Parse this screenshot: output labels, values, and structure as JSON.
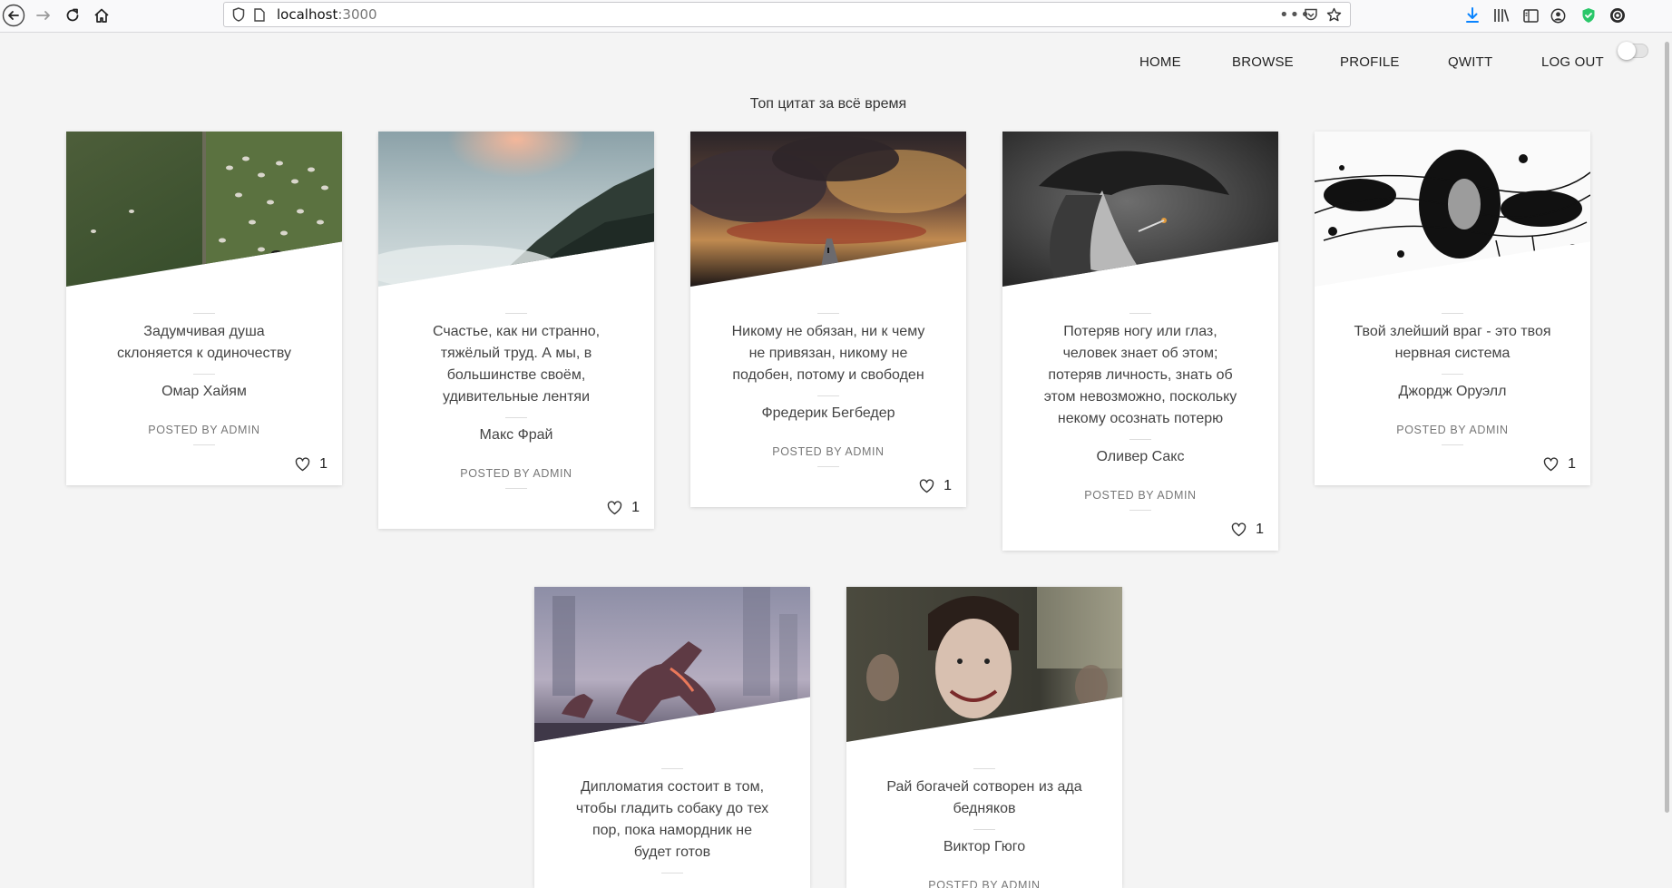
{
  "browser": {
    "url_host": "localhost",
    "url_port": ":3000",
    "icons": [
      "back-icon",
      "forward-icon",
      "reload-icon",
      "home-icon",
      "shield-icon",
      "page-icon",
      "more-icon",
      "pocket-icon",
      "bookmark-star-icon",
      "download-icon",
      "library-icon",
      "sidebar-icon",
      "account-icon",
      "extension-shield-icon",
      "extension-icon"
    ]
  },
  "nav": {
    "home": "HOME",
    "browse": "BROWSE",
    "profile": "PROFILE",
    "qwitt": "QWITT",
    "logout": "LOG OUT"
  },
  "page_title": "Топ цитат за всё время",
  "cards": [
    {
      "quote_lines": [
        "Задумчивая душа",
        "склоняется к одиночеству"
      ],
      "author": "Омар Хайям",
      "posted": "POSTED BY ADMIN",
      "likes": "1"
    },
    {
      "quote_lines": [
        "Счастье, как ни странно,",
        "тяжёлый труд. А мы, в",
        "большинстве своём,",
        "удивительные лентяи"
      ],
      "author": "Макс Фрай",
      "posted": "POSTED BY ADMIN",
      "likes": "1"
    },
    {
      "quote_lines": [
        "Никому не обязан, ни к чему",
        "не привязан, никому не",
        "подобен, потому и свободен"
      ],
      "author": "Фредерик Бегбедер",
      "posted": "POSTED BY ADMIN",
      "likes": "1"
    },
    {
      "quote_lines": [
        "Потеряв ногу или глаз,",
        "человек знает об этом;",
        "потеряв личность, знать об",
        "этом невозможно, поскольку",
        "некому осознать потерю"
      ],
      "author": "Оливер Сакс",
      "posted": "POSTED BY ADMIN",
      "likes": "1"
    },
    {
      "quote_lines": [
        "Твой злейший враг - это твоя",
        "нервная система"
      ],
      "author": "Джордж Оруэлл",
      "posted": "POSTED BY ADMIN",
      "likes": "1"
    },
    {
      "quote_lines": [
        "Дипломатия состоит в том,",
        "чтобы гладить собаку до тех",
        "пор, пока намордник не",
        "будет готов"
      ],
      "author": "",
      "posted": "",
      "likes": ""
    },
    {
      "quote_lines": [
        "Рай богачей сотворен из ада",
        "бедняков"
      ],
      "author": "Виктор Гюго",
      "posted": "POSTED BY ADMIN",
      "likes": ""
    }
  ],
  "colors": {
    "page_bg": "#f4f4f4",
    "card_bg": "#ffffff",
    "download_icon": "#0a84ff",
    "extension_shield": "#2ac769"
  }
}
